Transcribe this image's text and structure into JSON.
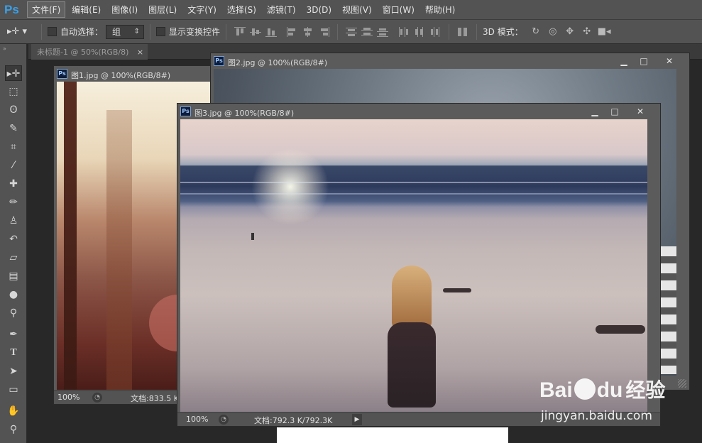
{
  "app": {
    "logo": "Ps"
  },
  "menu": [
    "文件(F)",
    "编辑(E)",
    "图像(I)",
    "图层(L)",
    "文字(Y)",
    "选择(S)",
    "滤镜(T)",
    "3D(D)",
    "视图(V)",
    "窗口(W)",
    "帮助(H)"
  ],
  "options": {
    "auto_select_label": "自动选择：",
    "auto_select_value": "组",
    "show_transform_label": "显示变换控件",
    "mode_3d_label": "3D 模式："
  },
  "doc_tab": {
    "label": "未标题-1 @ 50%(RGB/8)",
    "close": "×"
  },
  "windows": {
    "w1": {
      "title": "图1.jpg @ 100%(RGB/8#)",
      "zoom": "100%",
      "doc": "文档:833.5 K"
    },
    "w2": {
      "title": "图2.jpg @ 100%(RGB/8#)"
    },
    "w3": {
      "title": "图3.jpg @ 100%(RGB/8#)",
      "zoom": "100%",
      "doc": "文档:792.3 K/792.3K"
    }
  },
  "window_buttons": {
    "minimize": "▁",
    "maximize": "□",
    "close": "✕"
  },
  "watermark": {
    "brand": "Bai",
    "brand2": "du",
    "product": "经验",
    "url": "jingyan.baidu.com"
  }
}
